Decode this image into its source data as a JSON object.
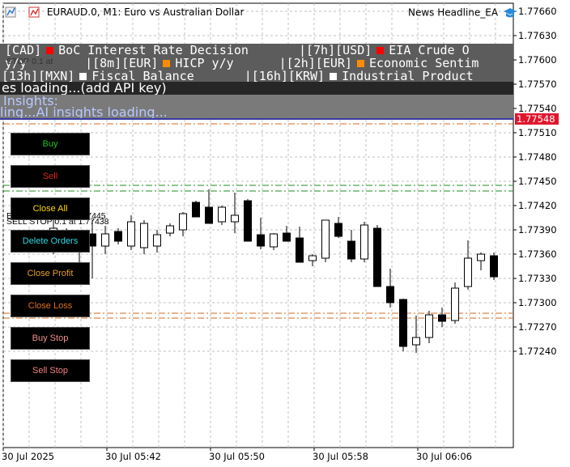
{
  "window": {
    "symbol_title": "EURAUD.0, M1:  Euro vs Australian Dollar",
    "ea_name": "News Headline_EA",
    "colors": {
      "bull": "#ffffff",
      "bear": "#000000",
      "grid": "#c0c0c0",
      "buy_line": "#228b22",
      "sell_line": "#d2691e",
      "current_price": "#e0162e"
    }
  },
  "price_axis": {
    "ticks": [
      "1.77660",
      "1.77630",
      "1.77600",
      "1.77570",
      "1.77540",
      "1.77510",
      "1.77480",
      "1.77450",
      "1.77420",
      "1.77390",
      "1.77360",
      "1.77330",
      "1.77300",
      "1.77270",
      "1.77240"
    ],
    "current_price": "1.77548"
  },
  "time_axis": {
    "labels": [
      "30 Jul 2025",
      "30 Jul 05:42",
      "30 Jul 05:50",
      "30 Jul 05:58",
      "30 Jul 06:06"
    ]
  },
  "news": {
    "row1": {
      "items": [
        {
          "prefix": "[CAD]",
          "color": "#ff0000",
          "text": "BoC Interest Rate Decision"
        },
        {
          "prefix": "|[7h][USD]",
          "color": "#ff0000",
          "text": "EIA Crude O"
        }
      ]
    },
    "row2": {
      "items": [
        {
          "prefix": "y/y",
          "color": "",
          "text": ""
        },
        {
          "prefix": "|[8m][EUR]",
          "color": "#ff8c00",
          "text": "HICP y/y"
        },
        {
          "prefix": "|[2h][EUR]",
          "color": "#ff8c00",
          "text": "Economic Sentim"
        }
      ]
    },
    "row3": {
      "items": [
        {
          "prefix": "[13h][MXN]",
          "color": "#ffffff",
          "text": "Fiscal Balance"
        },
        {
          "prefix": "|[16h][KRW]",
          "color": "#ffffff",
          "text": "Industrial Product"
        }
      ]
    },
    "api_status": "es loading...(add API key)",
    "ai_title": "Insights:",
    "ai_status": "ling...AI insights loading..."
  },
  "panel": {
    "buy": "Buy",
    "sell": "Sell",
    "close_all": "Close All",
    "delete_orders": "Delete Orders",
    "close_profit": "Close Profit",
    "close_loss": "Close Loss",
    "buy_stop": "Buy Stop",
    "sell_stop": "Sell Stop"
  },
  "orders": {
    "buy_stop_label": "BUY STOP 0.1 at 1.77445",
    "sell_stop_label": "SELL STOP 0.1 at 1.77438",
    "hidden_label": "STOP 0.1 at"
  },
  "chart_data": {
    "type": "candlestick",
    "price_range": [
      1.77222,
      1.77678
    ],
    "candles": [
      {
        "o": 1.7738,
        "h": 1.7742,
        "l": 1.7736,
        "c": 1.77392
      },
      {
        "o": 1.77382,
        "h": 1.77392,
        "l": 1.77376,
        "c": 1.77388
      },
      {
        "o": 1.77388,
        "h": 1.7739,
        "l": 1.7735,
        "c": 1.7738
      },
      {
        "o": 1.77385,
        "h": 1.77402,
        "l": 1.7733,
        "c": 1.7737
      },
      {
        "o": 1.7737,
        "h": 1.77395,
        "l": 1.7736,
        "c": 1.77385
      },
      {
        "o": 1.77388,
        "h": 1.77392,
        "l": 1.77372,
        "c": 1.77376
      },
      {
        "o": 1.7737,
        "h": 1.77408,
        "l": 1.77365,
        "c": 1.774
      },
      {
        "o": 1.77368,
        "h": 1.77402,
        "l": 1.7736,
        "c": 1.77398
      },
      {
        "o": 1.7737,
        "h": 1.7739,
        "l": 1.77362,
        "c": 1.77384
      },
      {
        "o": 1.77386,
        "h": 1.77398,
        "l": 1.77382,
        "c": 1.77395
      },
      {
        "o": 1.7739,
        "h": 1.77412,
        "l": 1.77382,
        "c": 1.7741
      },
      {
        "o": 1.77424,
        "h": 1.77426,
        "l": 1.77406,
        "c": 1.77406
      },
      {
        "o": 1.77418,
        "h": 1.7744,
        "l": 1.77398,
        "c": 1.77398
      },
      {
        "o": 1.774,
        "h": 1.7742,
        "l": 1.77396,
        "c": 1.77418
      },
      {
        "o": 1.774,
        "h": 1.77436,
        "l": 1.77386,
        "c": 1.77408
      },
      {
        "o": 1.77426,
        "h": 1.77428,
        "l": 1.77384,
        "c": 1.77376
      },
      {
        "o": 1.77384,
        "h": 1.77405,
        "l": 1.77366,
        "c": 1.7737
      },
      {
        "o": 1.77369,
        "h": 1.77386,
        "l": 1.77365,
        "c": 1.77385
      },
      {
        "o": 1.77386,
        "h": 1.77395,
        "l": 1.7738,
        "c": 1.77376
      },
      {
        "o": 1.7738,
        "h": 1.77394,
        "l": 1.7735,
        "c": 1.7735
      },
      {
        "o": 1.77352,
        "h": 1.7736,
        "l": 1.77345,
        "c": 1.77358
      },
      {
        "o": 1.77355,
        "h": 1.77402,
        "l": 1.7735,
        "c": 1.77402
      },
      {
        "o": 1.77398,
        "h": 1.77406,
        "l": 1.7738,
        "c": 1.77382
      },
      {
        "o": 1.77376,
        "h": 1.7739,
        "l": 1.7735,
        "c": 1.77354
      },
      {
        "o": 1.77354,
        "h": 1.774,
        "l": 1.7735,
        "c": 1.77396
      },
      {
        "o": 1.77392,
        "h": 1.77396,
        "l": 1.7732,
        "c": 1.7732
      },
      {
        "o": 1.7732,
        "h": 1.77342,
        "l": 1.77294,
        "c": 1.773
      },
      {
        "o": 1.77304,
        "h": 1.77305,
        "l": 1.7724,
        "c": 1.77246
      },
      {
        "o": 1.77248,
        "h": 1.77284,
        "l": 1.77238,
        "c": 1.77257
      },
      {
        "o": 1.77257,
        "h": 1.7729,
        "l": 1.7725,
        "c": 1.77285
      },
      {
        "o": 1.77285,
        "h": 1.77294,
        "l": 1.7727,
        "c": 1.77277
      },
      {
        "o": 1.77278,
        "h": 1.77325,
        "l": 1.77274,
        "c": 1.77318
      },
      {
        "o": 1.7732,
        "h": 1.77377,
        "l": 1.77316,
        "c": 1.77355
      },
      {
        "o": 1.77352,
        "h": 1.77362,
        "l": 1.7734,
        "c": 1.7736
      },
      {
        "o": 1.77358,
        "h": 1.77362,
        "l": 1.77328,
        "c": 1.77332
      }
    ],
    "buy_stop_price": 1.77445,
    "sell_stop_price": 1.77438,
    "upper_levels": [
      1.77521,
      1.77527
    ],
    "lower_levels": [
      1.77287,
      1.77281
    ],
    "current_price": 1.77548
  }
}
